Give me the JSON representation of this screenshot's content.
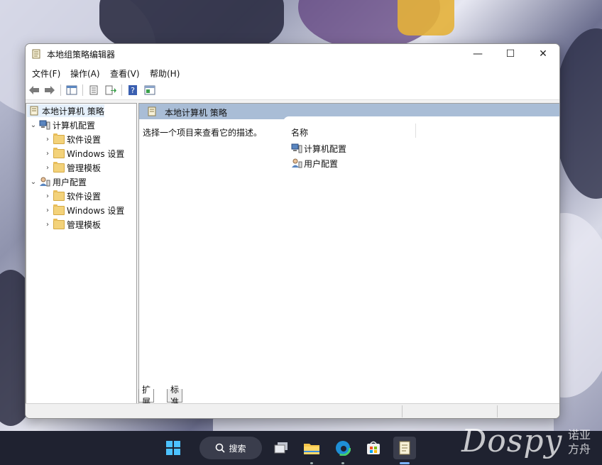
{
  "window": {
    "title": "本地组策略编辑器",
    "controls": {
      "minimize": "—",
      "maximize": "☐",
      "close": "✕"
    }
  },
  "menubar": {
    "items": [
      "文件(F)",
      "操作(A)",
      "查看(V)",
      "帮助(H)"
    ]
  },
  "toolbar": {
    "icons": [
      "back-arrow-icon",
      "forward-arrow-icon",
      "show-tree-icon",
      "properties-icon",
      "export-icon",
      "help-icon",
      "console-icon"
    ]
  },
  "tree": {
    "root": "本地计算机 策略",
    "computer_config": {
      "label": "计算机配置",
      "children": [
        "软件设置",
        "Windows 设置",
        "管理模板"
      ]
    },
    "user_config": {
      "label": "用户配置",
      "children": [
        "软件设置",
        "Windows 设置",
        "管理模板"
      ]
    }
  },
  "right_pane": {
    "header": "本地计算机 策略",
    "description": "选择一个项目来查看它的描述。",
    "column_name": "名称",
    "items": [
      "计算机配置",
      "用户配置"
    ]
  },
  "tabs": [
    "扩展",
    "标准"
  ],
  "taskbar": {
    "search_label": "搜索",
    "apps": [
      "start-icon",
      "task-view-icon",
      "file-explorer-icon",
      "edge-icon",
      "store-icon",
      "gpedit-icon"
    ]
  },
  "watermark": {
    "brand": "Dospy",
    "cn_line1": "诺亚",
    "cn_line2": "方舟"
  },
  "colors": {
    "header_bar": "#a9bdd6",
    "selection": "#e5f0fb",
    "taskbar": "#1f2230"
  }
}
